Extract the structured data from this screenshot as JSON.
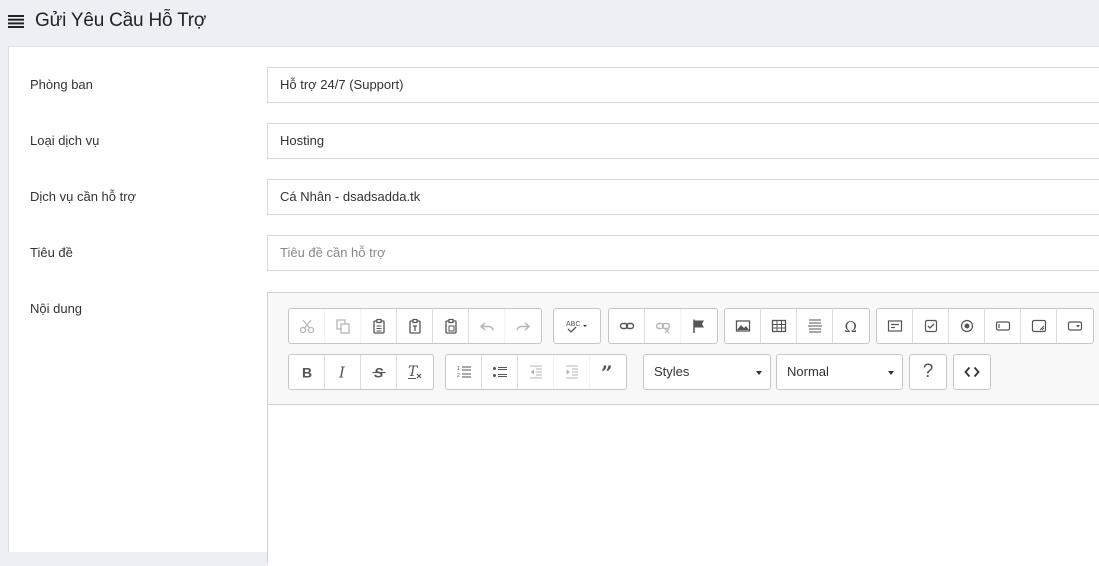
{
  "header": {
    "title": "Gửi Yêu Cầu Hỗ Trợ",
    "icon": "list-icon"
  },
  "form": {
    "department_label": "Phòng ban",
    "department_value": "Hỗ trợ 24/7 (Support)",
    "service_type_label": "Loại dịch vụ",
    "service_type_value": "Hosting",
    "service_label": "Dịch vụ cần hỗ trợ",
    "service_value": "Cá Nhân - dsadsadda.tk",
    "subject_label": "Tiêu đề",
    "subject_placeholder": "Tiêu đề cần hỗ trợ",
    "content_label": "Nội dung"
  },
  "editor": {
    "styles_label": "Styles",
    "format_label": "Normal",
    "help_label": "?"
  },
  "colors": {
    "background": "#eceff3",
    "panel": "#ffffff",
    "border": "#d6d9dd"
  }
}
